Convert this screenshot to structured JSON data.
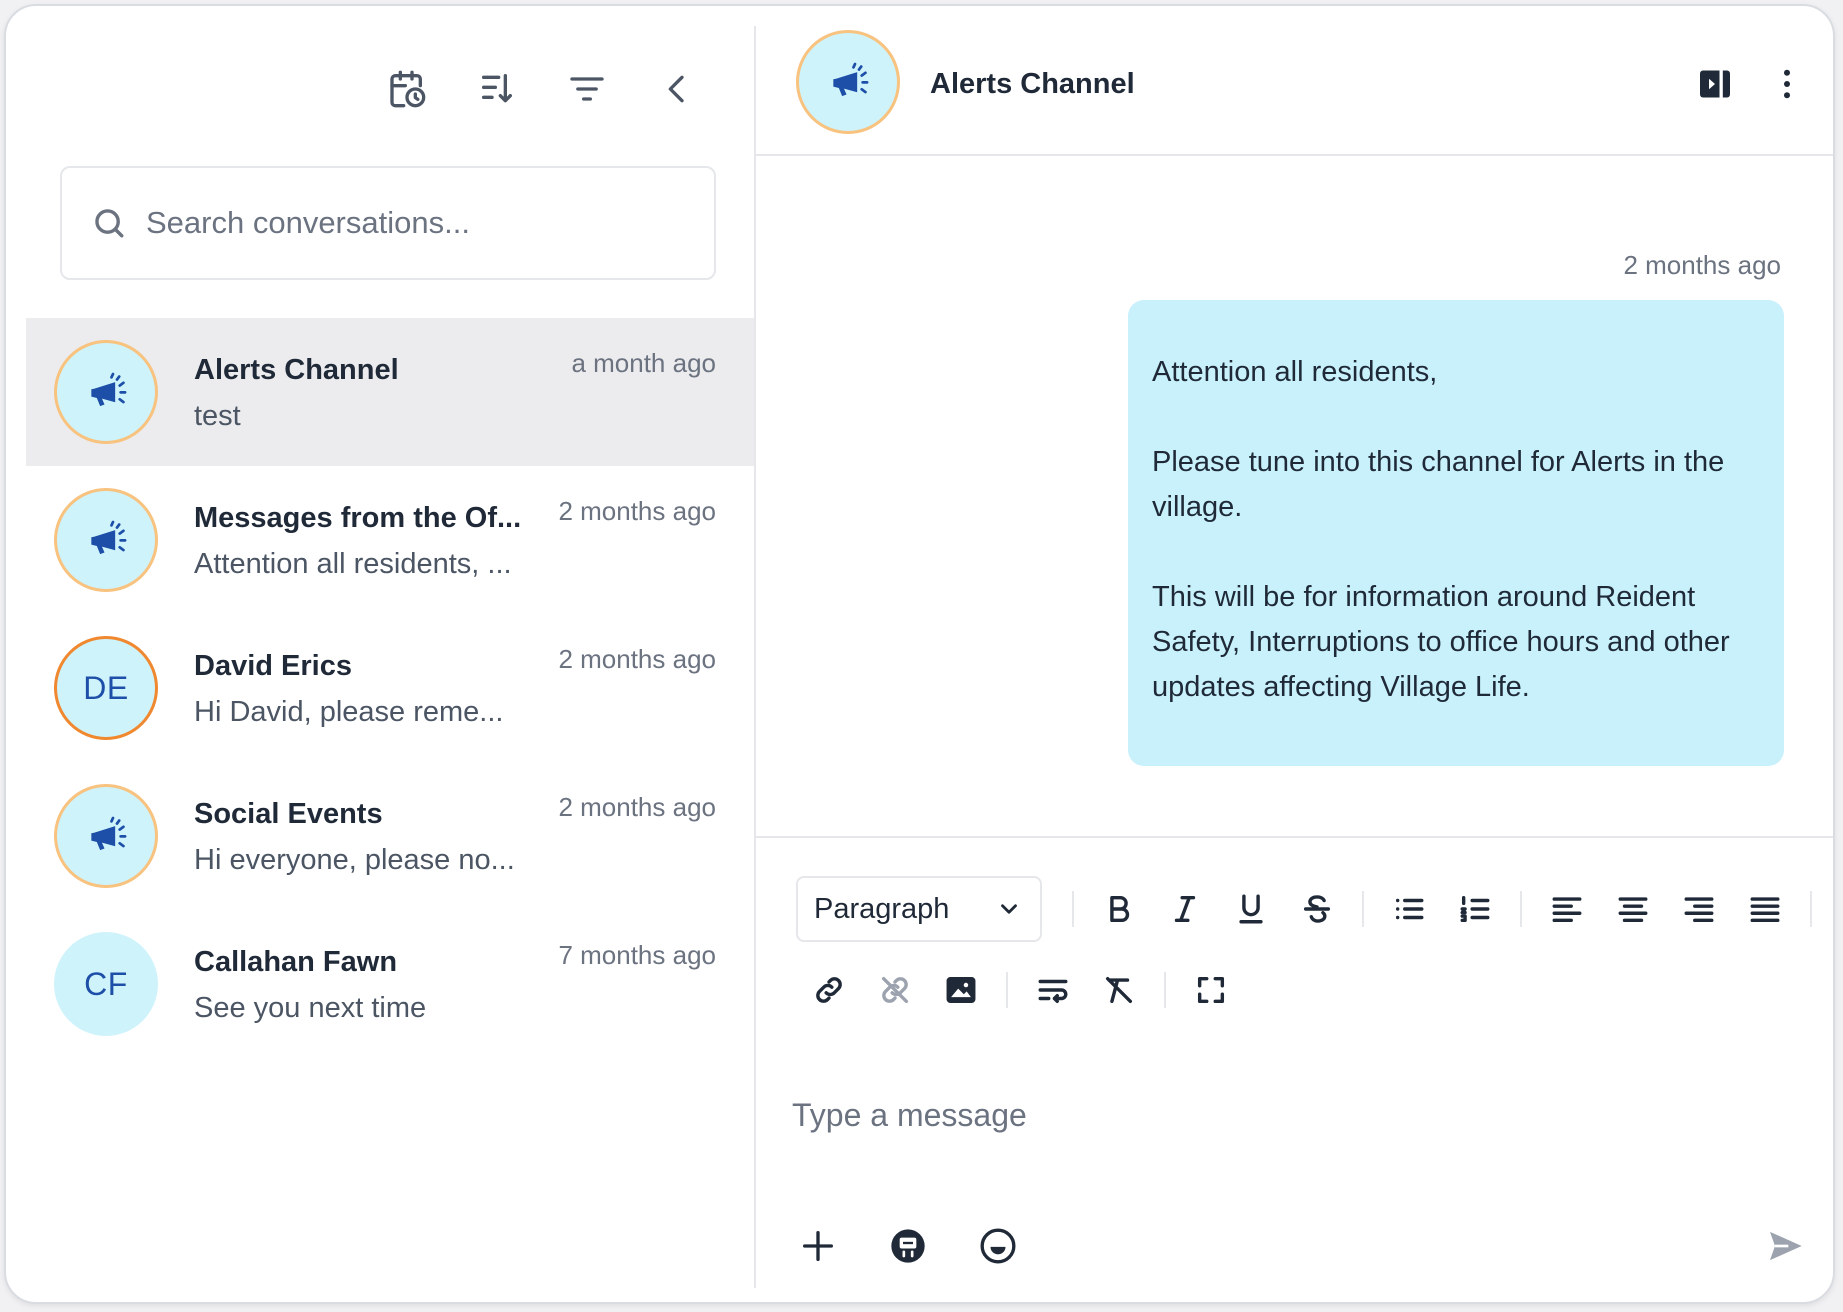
{
  "sidebar": {
    "toolbar": {
      "icons": [
        "calendar-clock-icon",
        "sort-icon",
        "filter-icon",
        "chevron-left-icon"
      ]
    },
    "search": {
      "placeholder": "Search conversations..."
    },
    "conversations": [
      {
        "name": "Alerts Channel",
        "preview": "test",
        "time": "a month ago",
        "avatar_type": "icon",
        "avatar_icon": "megaphone-icon",
        "initials": "",
        "active": true
      },
      {
        "name": "Messages from the Of...",
        "preview": "Attention all residents, ...",
        "time": "2 months ago",
        "avatar_type": "icon",
        "avatar_icon": "megaphone-icon",
        "initials": "",
        "active": false
      },
      {
        "name": "David Erics",
        "preview": "Hi David, please reme...",
        "time": "2 months ago",
        "avatar_type": "initials",
        "avatar_icon": "",
        "initials": "DE",
        "active": false
      },
      {
        "name": "Social Events",
        "preview": "Hi everyone, please no...",
        "time": "2 months ago",
        "avatar_type": "icon",
        "avatar_icon": "megaphone-icon",
        "initials": "",
        "active": false
      },
      {
        "name": "Callahan Fawn",
        "preview": "See you next time",
        "time": "7 months ago",
        "avatar_type": "initials",
        "avatar_icon": "",
        "initials": "CF",
        "active": false
      }
    ]
  },
  "header": {
    "title": "Alerts Channel",
    "avatar_icon": "megaphone-icon",
    "actions": [
      "toggle-panel-icon",
      "more-vertical-icon"
    ]
  },
  "thread": {
    "messages": [
      {
        "time": "2 months ago",
        "paragraphs": [
          "Attention all residents,",
          "Please tune into this channel for Alerts in the village.",
          "This will be for information around Reident Safety, Interruptions to office hours and other updates affecting Village Life."
        ]
      }
    ]
  },
  "composer": {
    "block_format": "Paragraph",
    "toolbar_row1": [
      "bold-icon",
      "italic-icon",
      "underline-icon",
      "strikethrough-icon",
      "bullet-list-icon",
      "numbered-list-icon",
      "align-left-icon",
      "align-center-icon",
      "align-right-icon",
      "align-justify-icon"
    ],
    "toolbar_row2": [
      "link-icon",
      "unlink-icon",
      "image-icon",
      "text-wrap-icon",
      "clear-format-icon",
      "fullscreen-icon"
    ],
    "input_placeholder": "Type a message",
    "bottom_actions": [
      "plus-icon",
      "canned-response-icon",
      "emoji-icon",
      "send-icon"
    ]
  },
  "colors": {
    "avatar_bg": "#cff3fb",
    "avatar_ring": "#f8c27f",
    "avatar_ring_strong": "#f0882f",
    "icon_blue": "#1d4fa8",
    "bubble_bg": "#c8f1fb",
    "active_row_bg": "#ececee"
  }
}
